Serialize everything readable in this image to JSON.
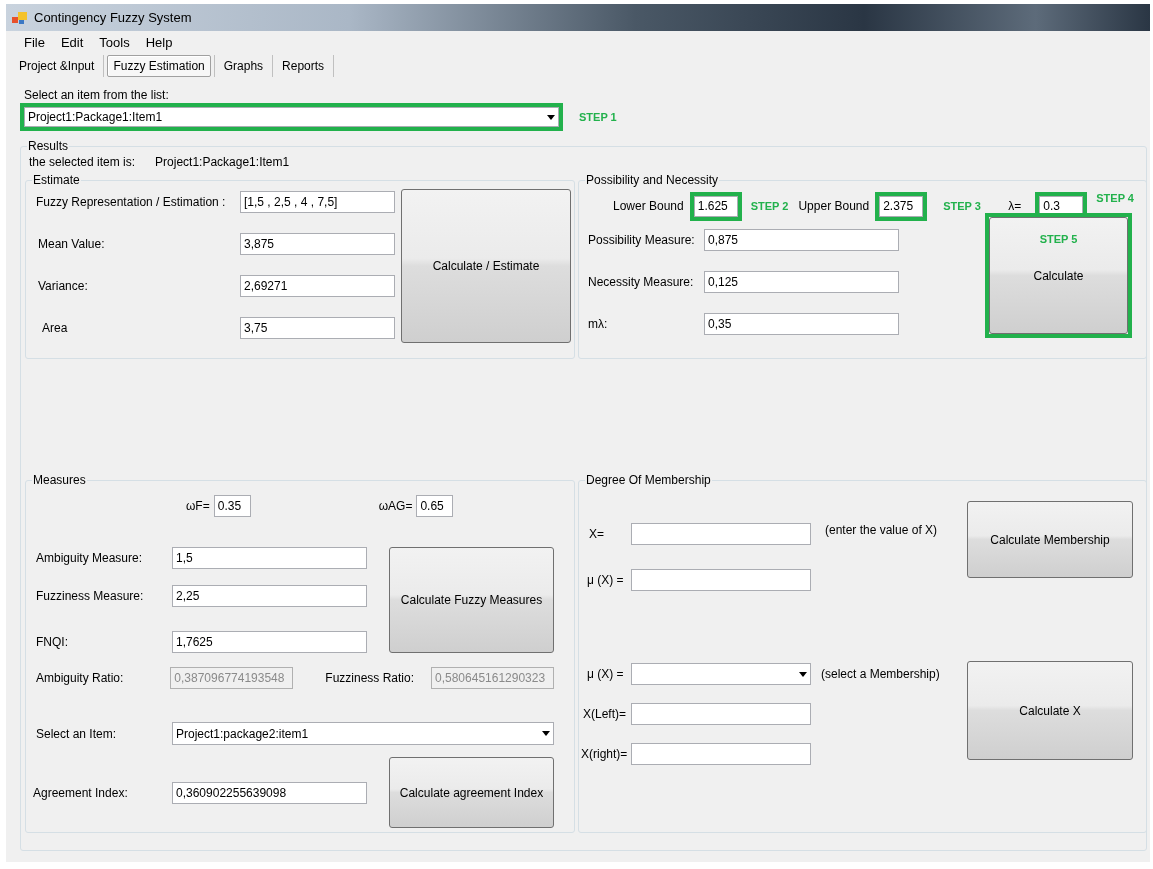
{
  "window": {
    "title": "Contingency Fuzzy System"
  },
  "menu": [
    "File",
    "Edit",
    "Tools",
    "Help"
  ],
  "tabs": [
    {
      "label": "Project &Input",
      "selected": false
    },
    {
      "label": "Fuzzy Estimation",
      "selected": true
    },
    {
      "label": "Graphs",
      "selected": false
    },
    {
      "label": "Reports",
      "selected": false
    }
  ],
  "item_select": {
    "label": "Select an item from the list:",
    "value": "Project1:Package1:Item1",
    "highlighted": true,
    "step": "STEP 1"
  },
  "results": {
    "title": "Results",
    "selected_label": "the selected item is:",
    "selected_value": "Project1:Package1:Item1"
  },
  "estimate": {
    "title": "Estimate",
    "fields": [
      {
        "label": "Fuzzy Representation / Estimation :",
        "value": "[1,5 , 2,5 , 4 , 7,5]"
      },
      {
        "label": "Mean Value:",
        "value": "3,875"
      },
      {
        "label": "Variance:",
        "value": "2,69271"
      },
      {
        "label": "Area",
        "value": "3,75"
      }
    ],
    "button": {
      "label": "Calculate / Estimate"
    }
  },
  "possibility": {
    "title": "Possibility and Necessity",
    "bounds": [
      {
        "label": "Lower Bound",
        "value": "1.625",
        "highlighted": true,
        "step": "STEP 2"
      },
      {
        "label": "Upper Bound",
        "value": "2.375",
        "highlighted": true,
        "step": "STEP 3"
      },
      {
        "label": "λ=",
        "value": "0.3",
        "highlighted": true,
        "step": "STEP 4"
      }
    ],
    "fields": [
      {
        "label": "Possibility Measure:",
        "value": "0,875"
      },
      {
        "label": "Necessity Measure:",
        "value": "0,125"
      },
      {
        "label": "mλ:",
        "value": "0,35"
      }
    ],
    "button": {
      "label": "Calculate",
      "highlighted": true,
      "step": "STEP 5"
    }
  },
  "measures": {
    "title": "Measures",
    "weights": [
      {
        "label": "ωF=",
        "value": "0.35"
      },
      {
        "label": "ωAG=",
        "value": "0.65"
      }
    ],
    "fields": [
      {
        "label": "Ambiguity Measure:",
        "value": "1,5"
      },
      {
        "label": "Fuzziness Measure:",
        "value": "2,25"
      },
      {
        "label": "FNQI:",
        "value": "1,7625"
      }
    ],
    "button": {
      "label": "Calculate Fuzzy Measures"
    },
    "ratios": [
      {
        "label": "Ambiguity Ratio:",
        "value": "0,387096774193548",
        "disabled": true
      },
      {
        "label": "Fuzziness Ratio:",
        "value": "0,580645161290323",
        "disabled": true
      }
    ],
    "item_select": {
      "label": "Select an Item:",
      "value": "Project1:package2:item1"
    },
    "agreement": {
      "label": "Agreement Index:",
      "value": "0,360902255639098"
    },
    "agreement_button": {
      "label": "Calculate agreement Index"
    }
  },
  "membership": {
    "title": "Degree Of Membership",
    "x_field": {
      "label": "X=",
      "note": "(enter the value of X)"
    },
    "mu_field": {
      "label": "μ (X) ="
    },
    "button": {
      "label": "Calculate Membership"
    },
    "mu_select": {
      "label": "μ (X) =",
      "note": "(select a Membership)"
    },
    "left_field": {
      "label": "X(Left)="
    },
    "right_field": {
      "label": "X(right)="
    },
    "x_button": {
      "label": "Calculate X"
    }
  }
}
